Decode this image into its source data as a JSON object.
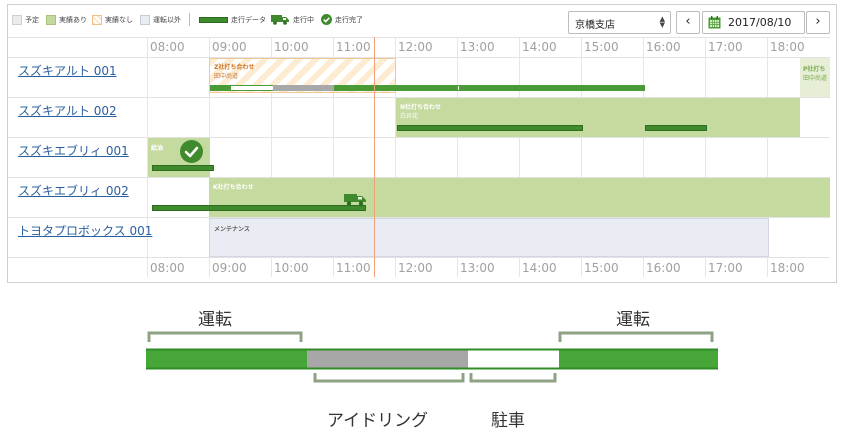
{
  "legend": {
    "plan": "予定",
    "actual": "実績あり",
    "no_actual": "実績なし",
    "non_driving": "運転以外",
    "run_data": "走行データ",
    "running": "走行中",
    "run_done": "走行完了"
  },
  "controls": {
    "office": "京橋支店",
    "date": "2017/08/10"
  },
  "hours": [
    "08:00",
    "09:00",
    "10:00",
    "11:00",
    "12:00",
    "13:00",
    "14:00",
    "15:00",
    "16:00",
    "17:00",
    "18:00"
  ],
  "vehicles": [
    {
      "name": "スズキアルト 001"
    },
    {
      "name": "スズキアルト 002"
    },
    {
      "name": "スズキエブリィ 001"
    },
    {
      "name": "スズキエブリィ 002"
    },
    {
      "name": "トヨタプロボックス 001"
    }
  ],
  "schedule": {
    "z_meeting": {
      "title": "Z社打ち合わせ",
      "person": "田中尚道"
    },
    "p_meeting": {
      "title": "P社打ち",
      "person": "田中尚道"
    },
    "n_meeting": {
      "title": "N社打ち合わせ",
      "person": "白井花"
    },
    "refuel": {
      "title": "給油"
    },
    "k_meeting": {
      "title": "K社打ち合わせ"
    },
    "maintenance": {
      "title": "メンテナンス"
    }
  },
  "diagram": {
    "drive_left": "運転",
    "drive_right": "運転",
    "idling": "アイドリング",
    "parking": "駐車"
  },
  "colors": {
    "actual": "#c4da9e",
    "run_bar": "#4a9b35",
    "idle_bar": "#a8a8a8",
    "now_line": "#f1a07a",
    "link": "#2a5fa0"
  },
  "icons": [
    "calendar-icon",
    "truck-icon",
    "check-circle-icon",
    "chevron-left-icon",
    "chevron-right-icon"
  ]
}
